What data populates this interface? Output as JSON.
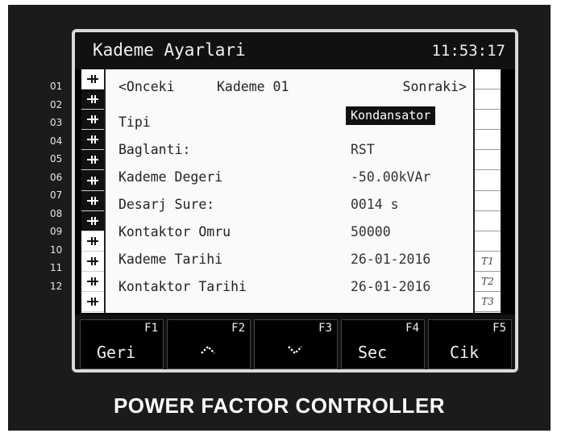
{
  "header": {
    "title": "Kademe Ayarlari",
    "clock": "11:53:17"
  },
  "channels": [
    "01",
    "02",
    "03",
    "04",
    "05",
    "06",
    "07",
    "08",
    "09",
    "10",
    "11",
    "12"
  ],
  "step_states": [
    "off",
    "on",
    "on",
    "on",
    "on",
    "on",
    "on",
    "on",
    "off",
    "off",
    "off",
    "off"
  ],
  "nav": {
    "prev_label": "<Onceki",
    "step_label": "Kademe 01",
    "next_label": "Sonraki>"
  },
  "fields": [
    {
      "label": "Tipi",
      "value": "Kondansator",
      "selected": true
    },
    {
      "label": "Baglanti:",
      "value": "RST"
    },
    {
      "label": "Kademe Degeri",
      "value": "-50.00kVAr"
    },
    {
      "label": "Desarj Sure:",
      "value": "0014 s"
    },
    {
      "label": "Kontaktor Omru",
      "value": "50000"
    },
    {
      "label": "Kademe Tarihi",
      "value": "26-01-2016"
    },
    {
      "label": "Kontaktor Tarihi",
      "value": "26-01-2016"
    }
  ],
  "right_markers": [
    "",
    "",
    "",
    "",
    "",
    "",
    "",
    "",
    "",
    "T1",
    "T2",
    "T3"
  ],
  "fkeys": [
    {
      "num": "F1",
      "label": "Geri"
    },
    {
      "num": "F2",
      "icon": "up-arrow-icon"
    },
    {
      "num": "F3",
      "icon": "down-arrow-icon"
    },
    {
      "num": "F4",
      "label": "Sec"
    },
    {
      "num": "F5",
      "label": "Cik"
    }
  ],
  "footer": "POWER FACTOR CONTROLLER"
}
